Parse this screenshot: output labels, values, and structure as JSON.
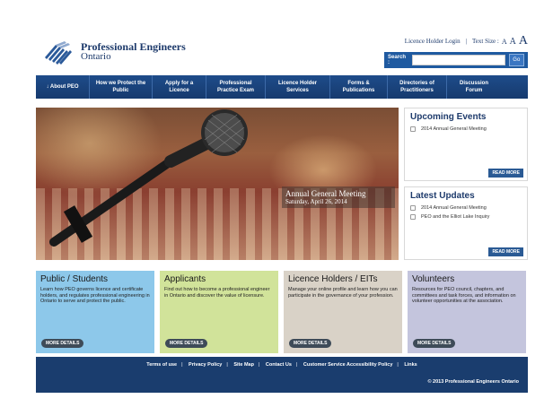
{
  "header": {
    "logo_line1": "Professional Engineers",
    "logo_line2": "Ontario",
    "login_label": "Licence Holder Login",
    "separator": "|",
    "text_size_label": "Text Size :",
    "text_size_small": "A",
    "text_size_medium": "A",
    "text_size_large": "A",
    "search_label": "Search :",
    "search_value": "",
    "search_button": "Go"
  },
  "nav": {
    "items": [
      {
        "label": "↓ About PEO"
      },
      {
        "label": "How we Protect the Public"
      },
      {
        "label": "Apply for a Licence"
      },
      {
        "label": "Professional Practice Exam"
      },
      {
        "label": "Licence Holder Services"
      },
      {
        "label": "Forms & Publications"
      },
      {
        "label": "Directories of Practitioners"
      },
      {
        "label": "Discussion Forum"
      }
    ]
  },
  "hero": {
    "title": "Annual General Meeting",
    "date": "Saturday, April 26, 2014"
  },
  "sidebar": {
    "events": {
      "title": "Upcoming Events",
      "items": [
        "2014 Annual General Meeting"
      ],
      "more": "READ MORE"
    },
    "updates": {
      "title": "Latest Updates",
      "items": [
        "2014 Annual General Meeting",
        "PEO and the Elliot Lake Inquiry"
      ],
      "more": "READ MORE"
    }
  },
  "cards": [
    {
      "title": "Public / Students",
      "text": "Learn how PEO governs licence and certificate holders, and regulates professional engineering in Ontario to serve and protect the public.",
      "button": "MORE DETAILS",
      "color": "#8dc8ea"
    },
    {
      "title": "Applicants",
      "text": "Find out how to become a professional engineer in Ontario and discover the value of licensure.",
      "button": "MORE DETAILS",
      "color": "#d1e39a"
    },
    {
      "title": "Licence Holders / EITs",
      "text": "Manage your online profile and learn how you can participate in the governance of your profession.",
      "button": "MORE DETAILS",
      "color": "#d9d2c7"
    },
    {
      "title": "Volunteers",
      "text": "Resources for PEO council, chapters, and committees and task forces, and information on volunteer opportunities at the association.",
      "button": "MORE DETAILS",
      "color": "#c4c5dd"
    }
  ],
  "footer": {
    "links": [
      "Terms of use",
      "Privacy Policy",
      "Site Map",
      "Contact Us",
      "Customer Service Accessibility Policy",
      "Links"
    ],
    "copyright": "© 2013 Professional Engineers Ontario"
  }
}
